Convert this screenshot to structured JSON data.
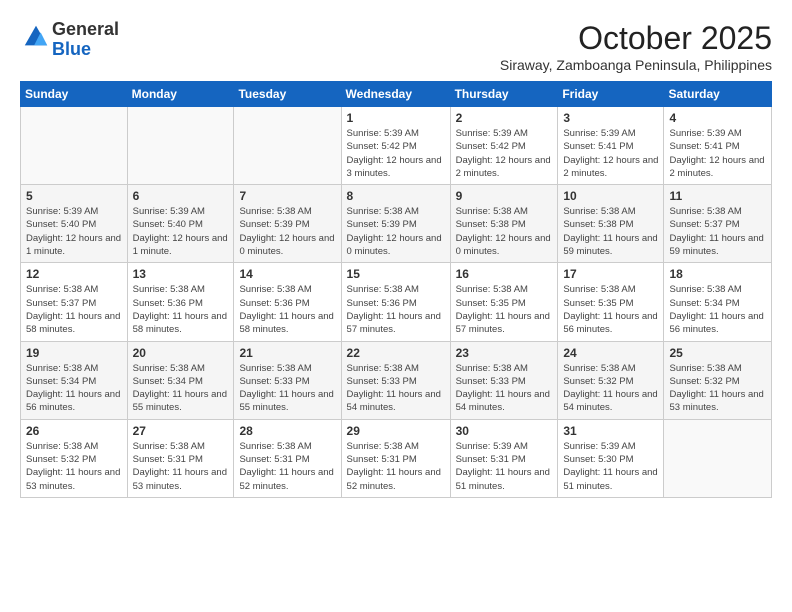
{
  "logo": {
    "general": "General",
    "blue": "Blue"
  },
  "header": {
    "month": "October 2025",
    "location": "Siraway, Zamboanga Peninsula, Philippines"
  },
  "weekdays": [
    "Sunday",
    "Monday",
    "Tuesday",
    "Wednesday",
    "Thursday",
    "Friday",
    "Saturday"
  ],
  "weeks": [
    [
      {
        "day": "",
        "info": ""
      },
      {
        "day": "",
        "info": ""
      },
      {
        "day": "",
        "info": ""
      },
      {
        "day": "1",
        "info": "Sunrise: 5:39 AM\nSunset: 5:42 PM\nDaylight: 12 hours and 3 minutes."
      },
      {
        "day": "2",
        "info": "Sunrise: 5:39 AM\nSunset: 5:42 PM\nDaylight: 12 hours and 2 minutes."
      },
      {
        "day": "3",
        "info": "Sunrise: 5:39 AM\nSunset: 5:41 PM\nDaylight: 12 hours and 2 minutes."
      },
      {
        "day": "4",
        "info": "Sunrise: 5:39 AM\nSunset: 5:41 PM\nDaylight: 12 hours and 2 minutes."
      }
    ],
    [
      {
        "day": "5",
        "info": "Sunrise: 5:39 AM\nSunset: 5:40 PM\nDaylight: 12 hours and 1 minute."
      },
      {
        "day": "6",
        "info": "Sunrise: 5:39 AM\nSunset: 5:40 PM\nDaylight: 12 hours and 1 minute."
      },
      {
        "day": "7",
        "info": "Sunrise: 5:38 AM\nSunset: 5:39 PM\nDaylight: 12 hours and 0 minutes."
      },
      {
        "day": "8",
        "info": "Sunrise: 5:38 AM\nSunset: 5:39 PM\nDaylight: 12 hours and 0 minutes."
      },
      {
        "day": "9",
        "info": "Sunrise: 5:38 AM\nSunset: 5:38 PM\nDaylight: 12 hours and 0 minutes."
      },
      {
        "day": "10",
        "info": "Sunrise: 5:38 AM\nSunset: 5:38 PM\nDaylight: 11 hours and 59 minutes."
      },
      {
        "day": "11",
        "info": "Sunrise: 5:38 AM\nSunset: 5:37 PM\nDaylight: 11 hours and 59 minutes."
      }
    ],
    [
      {
        "day": "12",
        "info": "Sunrise: 5:38 AM\nSunset: 5:37 PM\nDaylight: 11 hours and 58 minutes."
      },
      {
        "day": "13",
        "info": "Sunrise: 5:38 AM\nSunset: 5:36 PM\nDaylight: 11 hours and 58 minutes."
      },
      {
        "day": "14",
        "info": "Sunrise: 5:38 AM\nSunset: 5:36 PM\nDaylight: 11 hours and 58 minutes."
      },
      {
        "day": "15",
        "info": "Sunrise: 5:38 AM\nSunset: 5:36 PM\nDaylight: 11 hours and 57 minutes."
      },
      {
        "day": "16",
        "info": "Sunrise: 5:38 AM\nSunset: 5:35 PM\nDaylight: 11 hours and 57 minutes."
      },
      {
        "day": "17",
        "info": "Sunrise: 5:38 AM\nSunset: 5:35 PM\nDaylight: 11 hours and 56 minutes."
      },
      {
        "day": "18",
        "info": "Sunrise: 5:38 AM\nSunset: 5:34 PM\nDaylight: 11 hours and 56 minutes."
      }
    ],
    [
      {
        "day": "19",
        "info": "Sunrise: 5:38 AM\nSunset: 5:34 PM\nDaylight: 11 hours and 56 minutes."
      },
      {
        "day": "20",
        "info": "Sunrise: 5:38 AM\nSunset: 5:34 PM\nDaylight: 11 hours and 55 minutes."
      },
      {
        "day": "21",
        "info": "Sunrise: 5:38 AM\nSunset: 5:33 PM\nDaylight: 11 hours and 55 minutes."
      },
      {
        "day": "22",
        "info": "Sunrise: 5:38 AM\nSunset: 5:33 PM\nDaylight: 11 hours and 54 minutes."
      },
      {
        "day": "23",
        "info": "Sunrise: 5:38 AM\nSunset: 5:33 PM\nDaylight: 11 hours and 54 minutes."
      },
      {
        "day": "24",
        "info": "Sunrise: 5:38 AM\nSunset: 5:32 PM\nDaylight: 11 hours and 54 minutes."
      },
      {
        "day": "25",
        "info": "Sunrise: 5:38 AM\nSunset: 5:32 PM\nDaylight: 11 hours and 53 minutes."
      }
    ],
    [
      {
        "day": "26",
        "info": "Sunrise: 5:38 AM\nSunset: 5:32 PM\nDaylight: 11 hours and 53 minutes."
      },
      {
        "day": "27",
        "info": "Sunrise: 5:38 AM\nSunset: 5:31 PM\nDaylight: 11 hours and 53 minutes."
      },
      {
        "day": "28",
        "info": "Sunrise: 5:38 AM\nSunset: 5:31 PM\nDaylight: 11 hours and 52 minutes."
      },
      {
        "day": "29",
        "info": "Sunrise: 5:38 AM\nSunset: 5:31 PM\nDaylight: 11 hours and 52 minutes."
      },
      {
        "day": "30",
        "info": "Sunrise: 5:39 AM\nSunset: 5:31 PM\nDaylight: 11 hours and 51 minutes."
      },
      {
        "day": "31",
        "info": "Sunrise: 5:39 AM\nSunset: 5:30 PM\nDaylight: 11 hours and 51 minutes."
      },
      {
        "day": "",
        "info": ""
      }
    ]
  ]
}
